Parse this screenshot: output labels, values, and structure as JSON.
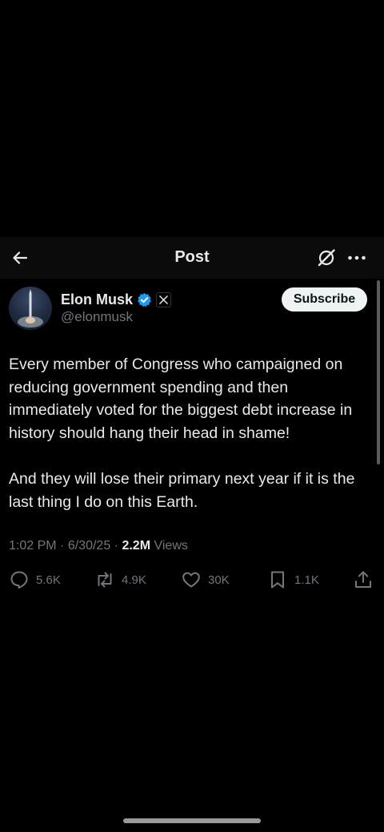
{
  "header": {
    "title": "Post",
    "back_icon": "arrow-left-icon",
    "grok_icon": "grok-icon",
    "more_icon": "more-horizontal-icon"
  },
  "author": {
    "name": "Elon Musk",
    "handle": "@elonmusk",
    "verified_icon": "verified-badge-icon",
    "affiliate_icon": "x-logo-icon",
    "subscribe_label": "Subscribe"
  },
  "post": {
    "paragraphs": [
      "Every member of Congress who campaigned on reducing government spending and then immediately voted for the biggest debt increase in history should hang their head in shame!",
      "And they will lose their primary next year if it is the last thing I do on this Earth."
    ],
    "time": "1:02 PM",
    "date": "6/30/25",
    "views_count": "2.2M",
    "views_label": "Views"
  },
  "actions": {
    "replies": "5.6K",
    "reposts": "4.9K",
    "likes": "30K",
    "bookmarks": "1.1K"
  },
  "colors": {
    "background": "#000000",
    "text": "#e7e9ea",
    "secondary": "#71767b",
    "verified": "#1d9bf0"
  }
}
